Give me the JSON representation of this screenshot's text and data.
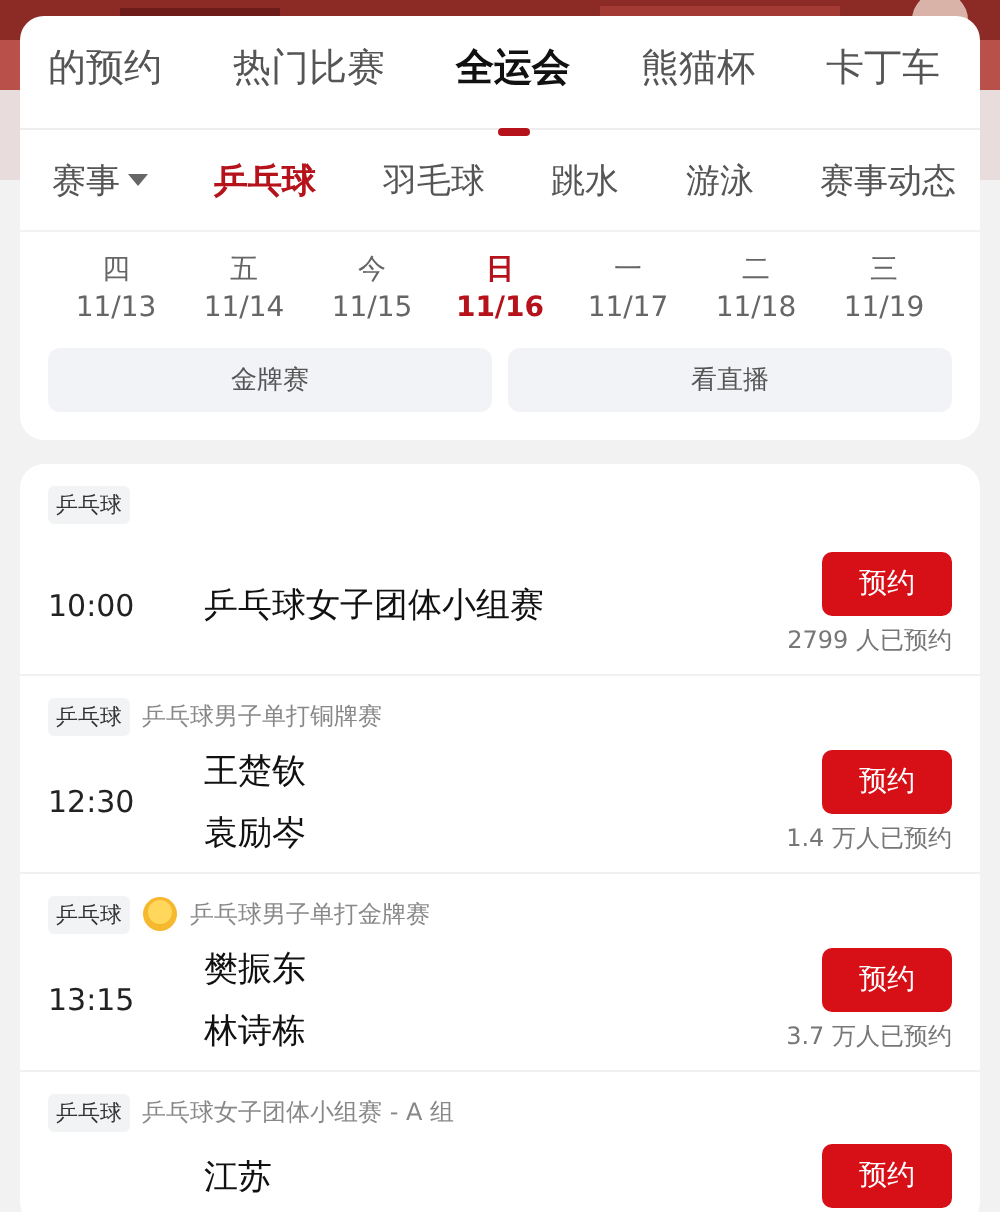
{
  "tabs": [
    {
      "label": "的预约",
      "selected": false
    },
    {
      "label": "热门比赛",
      "selected": false
    },
    {
      "label": "全运会",
      "selected": true
    },
    {
      "label": "熊猫杯",
      "selected": false
    },
    {
      "label": "卡丁车",
      "selected": false
    }
  ],
  "sub_tabs": [
    {
      "label": "赛事",
      "kind": "dropdown",
      "selected": false
    },
    {
      "label": "乒乓球",
      "kind": "tab",
      "selected": true
    },
    {
      "label": "羽毛球",
      "kind": "tab",
      "selected": false
    },
    {
      "label": "跳水",
      "kind": "tab",
      "selected": false
    },
    {
      "label": "游泳",
      "kind": "tab",
      "selected": false
    },
    {
      "label": "赛事动态",
      "kind": "tab",
      "selected": false
    }
  ],
  "dates": [
    {
      "weekday": "四",
      "date": "11/13",
      "selected": false
    },
    {
      "weekday": "五",
      "date": "11/14",
      "selected": false
    },
    {
      "weekday": "今",
      "date": "11/15",
      "selected": false
    },
    {
      "weekday": "日",
      "date": "11/16",
      "selected": true
    },
    {
      "weekday": "一",
      "date": "11/17",
      "selected": false
    },
    {
      "weekday": "二",
      "date": "11/18",
      "selected": false
    },
    {
      "weekday": "三",
      "date": "11/19",
      "selected": false
    }
  ],
  "filters": [
    "金牌赛",
    "看直播"
  ],
  "matches": [
    {
      "tag": "乒乓球",
      "medal": false,
      "time": "10:00",
      "players": [
        "乒乓球女子团体小组赛"
      ],
      "button": "预约",
      "count": "2799 人已预约"
    },
    {
      "tag": "乒乓球",
      "medal": false,
      "event": "乒乓球男子单打铜牌赛",
      "time": "12:30",
      "players": [
        "王楚钦",
        "袁励岑"
      ],
      "button": "预约",
      "count": "1.4 万人已预约"
    },
    {
      "tag": "乒乓球",
      "medal": true,
      "event": "乒乓球男子单打金牌赛",
      "time": "13:15",
      "players": [
        "樊振东",
        "林诗栋"
      ],
      "button": "预约",
      "count": "3.7 万人已预约"
    },
    {
      "tag": "乒乓球",
      "medal": false,
      "event": "乒乓球女子团体小组赛 - A 组",
      "players": [
        "江苏"
      ],
      "button": "预约"
    }
  ]
}
